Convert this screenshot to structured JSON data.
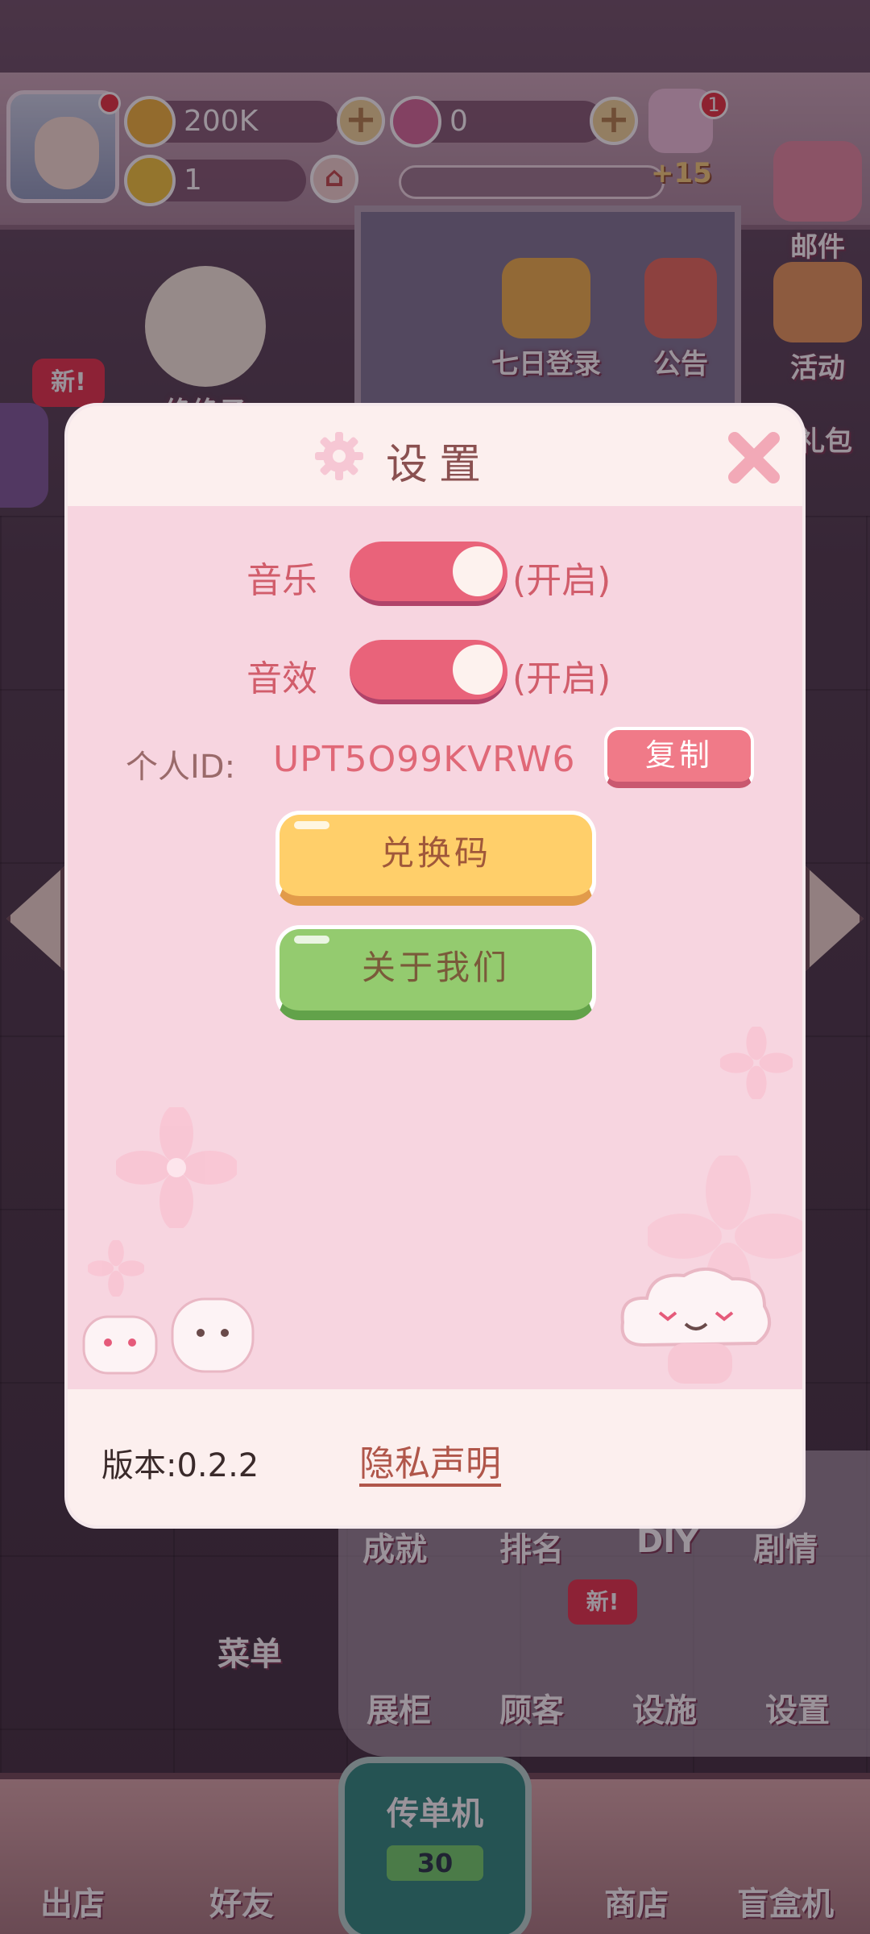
{
  "hud": {
    "coins": "200K",
    "gems": "0",
    "stars": "1",
    "event_badge_count": "1",
    "xp_bonus": "+15"
  },
  "side_menu": {
    "mail": "邮件",
    "events": "活动",
    "gift": "礼包",
    "seven_day": "七日登录",
    "notice": "公告",
    "great": "绝绝子",
    "new_badge": "新!"
  },
  "settings": {
    "title": "设置",
    "music_label": "音乐",
    "music_state": "(开启)",
    "sfx_label": "音效",
    "sfx_state": "(开启)",
    "id_label": "个人ID:",
    "id_value": "UPT5O99KVRW6",
    "copy_label": "复制",
    "redeem_label": "兑换码",
    "about_label": "关于我们",
    "version_label": "版本:0.2.2",
    "privacy_label": "隐私声明"
  },
  "bottom_panel": {
    "achievements": "成就",
    "ranking": "排名",
    "diy": "DIY",
    "story": "剧情",
    "menu": "菜单",
    "showcase": "展柜",
    "customers": "顾客",
    "facilities": "设施",
    "settings": "设置",
    "new_badge": "新!"
  },
  "dock": {
    "leave_shop": "出店",
    "friends": "好友",
    "leaflet": "传单机",
    "leaflet_count": "30",
    "shop": "商店",
    "blind_box": "盲盒机"
  },
  "colors": {
    "toggle_on": "#e9637a",
    "redeem": "#ffcf6a",
    "about": "#94cb6f",
    "copy": "#f07a88"
  }
}
